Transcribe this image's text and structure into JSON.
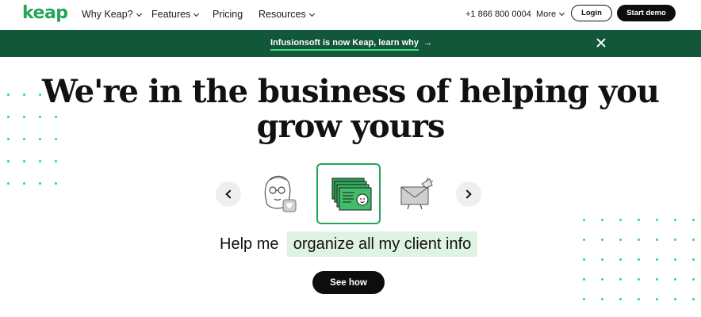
{
  "nav": {
    "logo": "keap",
    "items": [
      {
        "label": "Why Keap?",
        "has_dropdown": true
      },
      {
        "label": "Features",
        "has_dropdown": true
      },
      {
        "label": "Pricing",
        "has_dropdown": false
      },
      {
        "label": "Resources",
        "has_dropdown": true
      }
    ],
    "phone": "+1 866 800 0004",
    "more_label": "More",
    "login_label": "Login",
    "demo_label": "Start demo"
  },
  "banner": {
    "text": "Infusionsoft is now Keap, learn why",
    "arrow": "→",
    "close_icon": "close-icon"
  },
  "hero": {
    "headline_line1": "We're in the business of helping you",
    "headline_line2": "grow yours",
    "carousel": {
      "prev_icon": "chevron-left-icon",
      "next_icon": "chevron-right-icon",
      "items": [
        "face-illustration",
        "client-card-illustration",
        "mail-illustration"
      ],
      "active_index": 1
    },
    "help_prefix": "Help me",
    "help_value": "organize all my client info",
    "cta_label": "See how"
  },
  "colors": {
    "brand_green": "#24a557",
    "banner_green": "#12573a",
    "accent_dot": "#2fd48c",
    "highlight_bg": "#dff3e3",
    "button_dark": "#0d0d0d"
  }
}
